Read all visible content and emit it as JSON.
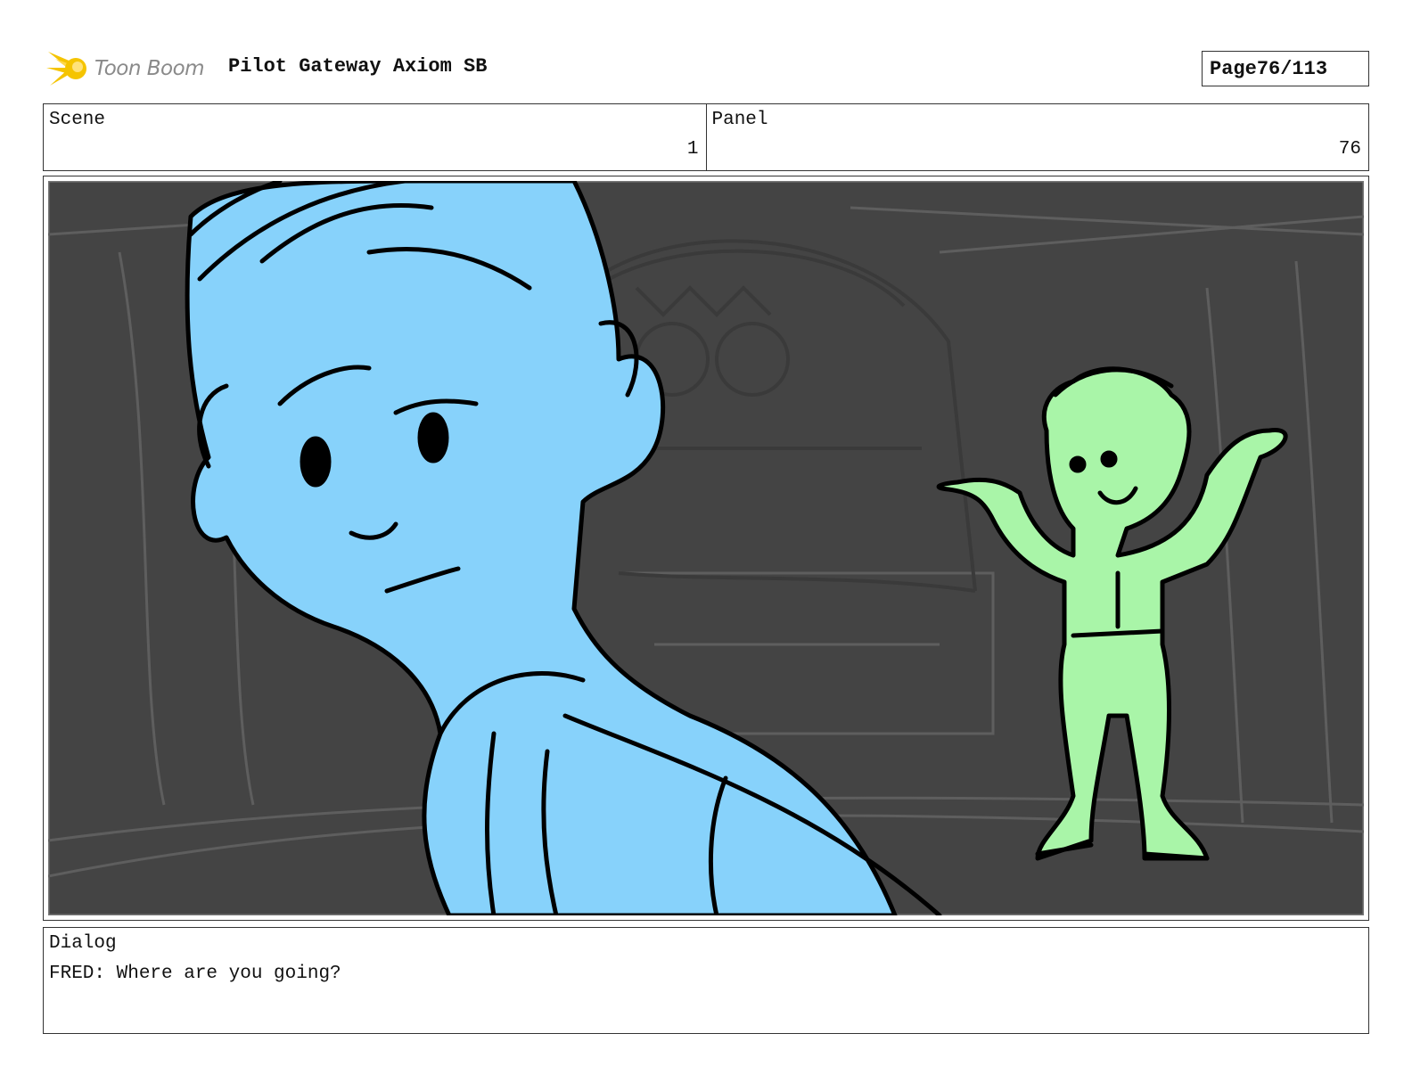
{
  "header": {
    "logo_text": "Toon Boom",
    "project_title": "Pilot Gateway Axiom SB",
    "page_label": "Page",
    "page_number": "76/113"
  },
  "info": {
    "scene_label": "Scene",
    "scene_value": "1",
    "panel_label": "Panel",
    "panel_value": "76"
  },
  "panel_art": {
    "background_color": "#444444",
    "character_left_color": "#87d2fb",
    "character_right_color": "#a9f5a8",
    "logo_color": "#f5c400"
  },
  "dialog": {
    "label": "Dialog",
    "text": "FRED: Where are you going?"
  }
}
